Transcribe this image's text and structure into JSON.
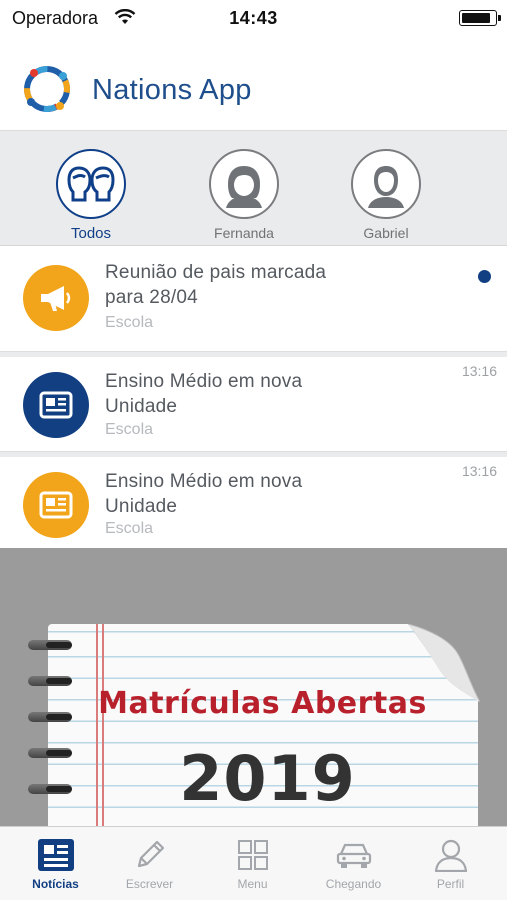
{
  "status_bar": {
    "carrier": "Operadora",
    "time": "14:43"
  },
  "header": {
    "title": "Nations App"
  },
  "profiles": [
    {
      "name": "Todos",
      "active": true
    },
    {
      "name": "Fernanda",
      "active": false
    },
    {
      "name": "Gabriel",
      "active": false
    }
  ],
  "feed": [
    {
      "title_line1": "Reunião de pais marcada",
      "title_line2": "para 28/04",
      "category": "Escola",
      "time": "",
      "unread": true,
      "icon": "megaphone-icon",
      "icon_color": "#f2a51a"
    },
    {
      "title_line1": "Ensino Médio em nova",
      "title_line2": "Unidade",
      "category": "Escola",
      "time": "13:16",
      "unread": false,
      "icon": "newspaper-icon",
      "icon_color": "#123f82"
    },
    {
      "title_line1": "Ensino Médio em nova",
      "title_line2": "Unidade",
      "category": "Escola",
      "time": "13:16",
      "unread": false,
      "icon": "newspaper-icon",
      "icon_color": "#f2a51a"
    }
  ],
  "banner": {
    "title": "Matrículas Abertas",
    "year": "2019"
  },
  "tabbar": [
    {
      "label": "Notícias",
      "icon": "news-icon",
      "active": true
    },
    {
      "label": "Escrever",
      "icon": "pencil-icon",
      "active": false
    },
    {
      "label": "Menu",
      "icon": "grid-icon",
      "active": false
    },
    {
      "label": "Chegando",
      "icon": "car-icon",
      "active": false
    },
    {
      "label": "Perfil",
      "icon": "person-icon",
      "active": false
    }
  ],
  "colors": {
    "brand_blue": "#123f82",
    "accent_orange": "#f2a51a",
    "banner_red": "#b8202c"
  }
}
